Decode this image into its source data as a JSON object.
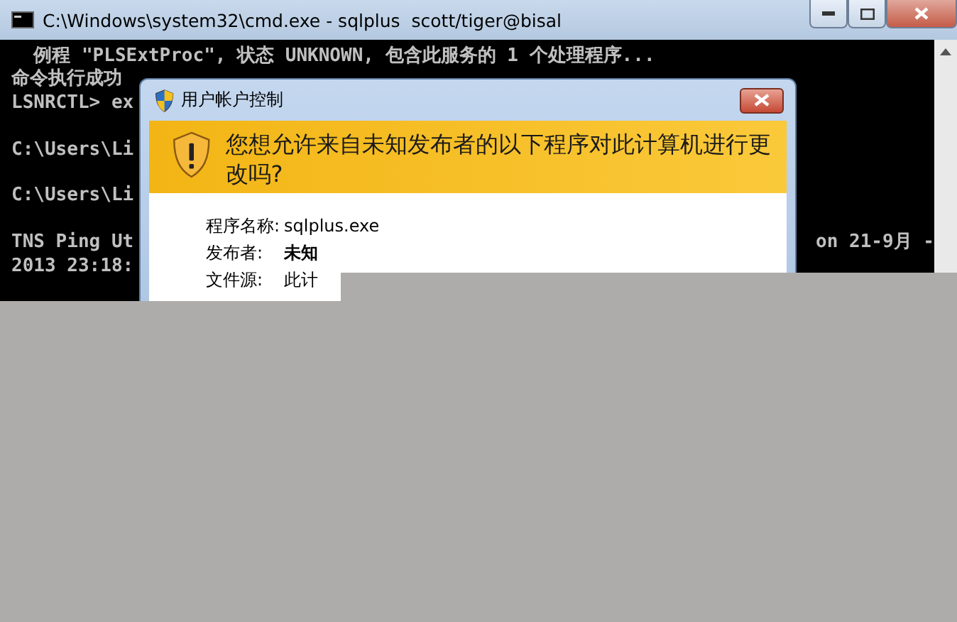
{
  "window": {
    "title": "C:\\Windows\\system32\\cmd.exe - sqlplus  scott/tiger@bisal"
  },
  "console": {
    "paragraphs": [
      [
        {
          "left": "  例程 \"PLSExtProc\", 状态 UNKNOWN, 包含此服务的 1 个处理程序..."
        },
        {
          "left": "命令执行成功"
        },
        {
          "left": "LSNRCTL> ex"
        }
      ],
      [
        {
          "left": "C:\\Users\\Li"
        }
      ],
      [
        {
          "left": "C:\\Users\\Li"
        }
      ],
      [
        {
          "left": "TNS Ping Ut",
          "right": "on 21-9月 -"
        },
        {
          "left": "2013 23:18:"
        }
      ]
    ]
  },
  "dialog": {
    "title": "用户帐户控制",
    "heading": "您想允许来自未知发布者的以下程序对此计算机进行更改吗?",
    "fields": [
      {
        "label": "程序名称:",
        "value": "sqlplus.exe",
        "bold": false
      },
      {
        "label": "发布者:",
        "value": "未知",
        "bold": true
      },
      {
        "label": "文件源:",
        "value": "此计",
        "bold": false
      }
    ]
  }
}
